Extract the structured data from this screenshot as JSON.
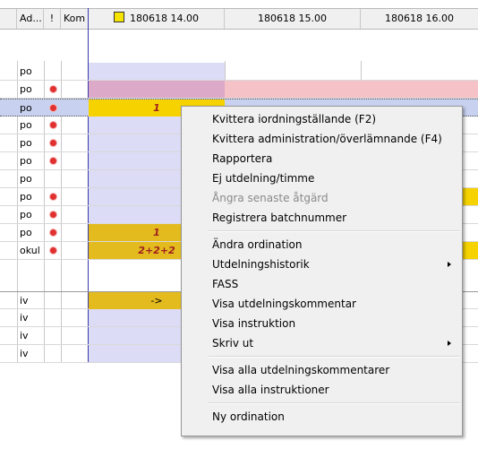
{
  "header": {
    "col_ad": "Ad...",
    "col_excl": "!",
    "col_kom": "Kom",
    "times": [
      "180618 14.00",
      "180618 15.00",
      "180618 16.00"
    ]
  },
  "rows": [
    {
      "route": "po",
      "flag": false,
      "cell14": ""
    },
    {
      "route": "po",
      "flag": true,
      "cell14": ""
    },
    {
      "route": "po",
      "flag": true,
      "cell14": "1"
    },
    {
      "route": "po",
      "flag": true,
      "cell14": ""
    },
    {
      "route": "po",
      "flag": true,
      "cell14": ""
    },
    {
      "route": "po",
      "flag": true,
      "cell14": ""
    },
    {
      "route": "po",
      "flag": false,
      "cell14": ""
    },
    {
      "route": "po",
      "flag": true,
      "cell14": ""
    },
    {
      "route": "po",
      "flag": true,
      "cell14": ""
    },
    {
      "route": "po",
      "flag": true,
      "cell14": "1"
    },
    {
      "route": "okul",
      "flag": true,
      "cell14": "2+2+2"
    }
  ],
  "rows2": [
    {
      "route": "iv",
      "cell14": "->"
    },
    {
      "route": "iv",
      "cell14": ""
    },
    {
      "route": "iv",
      "cell14": ""
    },
    {
      "route": "iv",
      "cell14": ""
    }
  ],
  "menu": {
    "items": [
      {
        "label": "Kvittera iordningställande (F2)",
        "disabled": false,
        "submenu": false
      },
      {
        "label": "Kvittera administration/överlämnande (F4)",
        "disabled": false,
        "submenu": false
      },
      {
        "label": "Rapportera",
        "disabled": false,
        "submenu": false
      },
      {
        "label": "Ej utdelning/timme",
        "disabled": false,
        "submenu": false
      },
      {
        "label": "Ångra senaste åtgärd",
        "disabled": true,
        "submenu": false
      },
      {
        "label": "Registrera batchnummer",
        "disabled": false,
        "submenu": false
      },
      {
        "label": "Ändra ordination",
        "disabled": false,
        "submenu": false
      },
      {
        "label": "Utdelningshistorik",
        "disabled": false,
        "submenu": true
      },
      {
        "label": "FASS",
        "disabled": false,
        "submenu": false
      },
      {
        "label": "Visa utdelningskommentar",
        "disabled": false,
        "submenu": false
      },
      {
        "label": "Visa instruktion",
        "disabled": false,
        "submenu": false
      },
      {
        "label": "Skriv ut",
        "disabled": false,
        "submenu": true
      },
      {
        "label": "Visa alla utdelningskommentarer",
        "disabled": false,
        "submenu": false
      },
      {
        "label": "Visa alla instruktioner",
        "disabled": false,
        "submenu": false
      },
      {
        "label": "Ny ordination",
        "disabled": false,
        "submenu": false
      }
    ]
  },
  "colors": {
    "lavender": "#dcdcf6",
    "pink": "#f5c2c8",
    "mauve": "#dcaac8",
    "yellow": "#f5d200",
    "gold": "#e3bb1e",
    "selected_row": "#c8d2f0",
    "dot": "#e0302f"
  }
}
